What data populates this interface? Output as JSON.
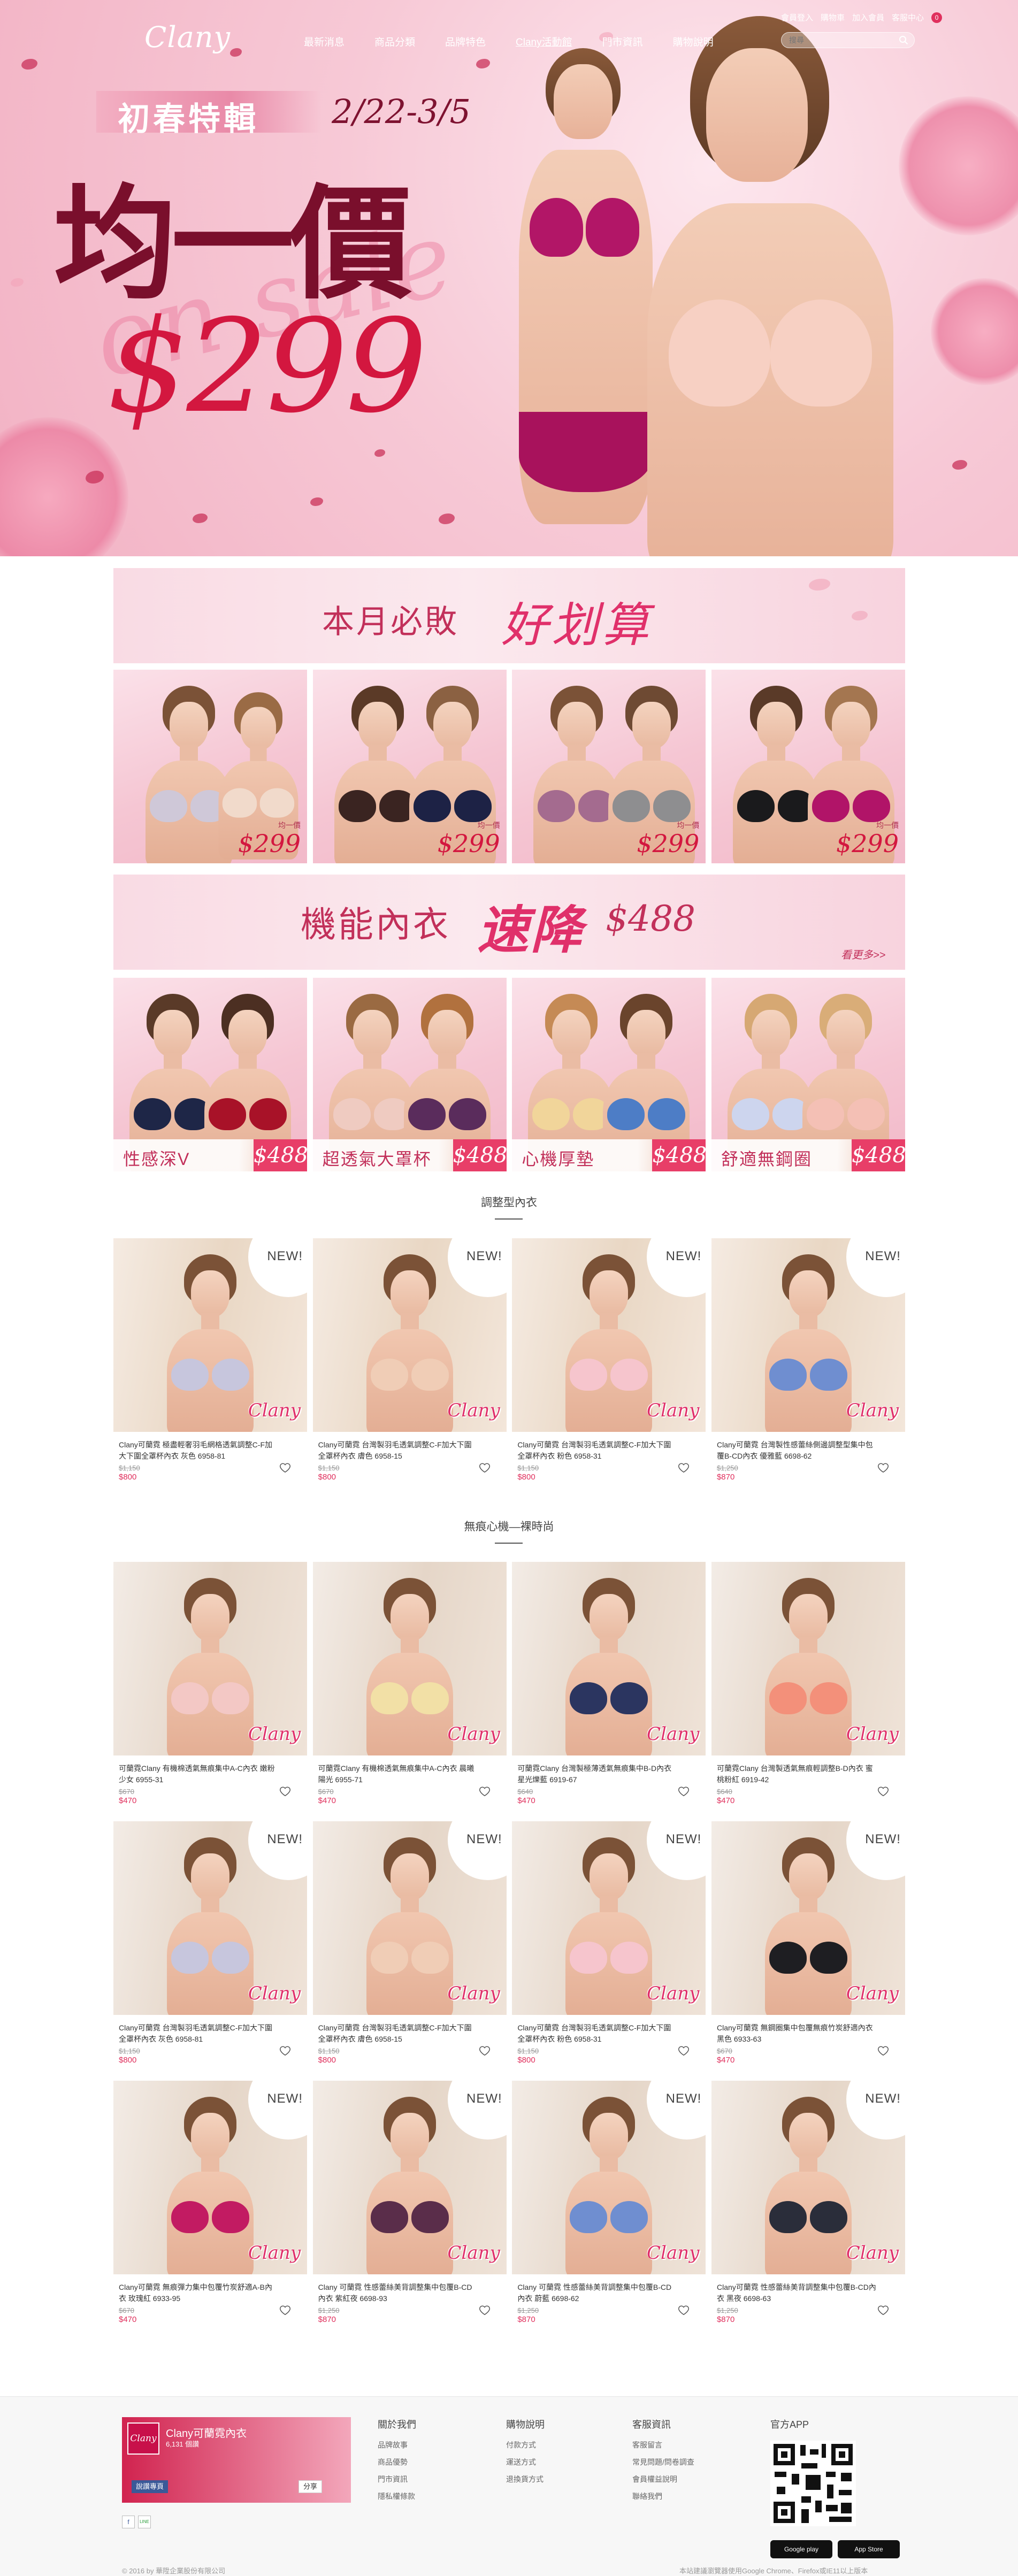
{
  "nav": {
    "logo": "Clany",
    "menu": [
      "最新消息",
      "商品分類",
      "品牌特色",
      "Clany活動館",
      "門市資訊",
      "購物說明"
    ],
    "active_index": 3,
    "util": [
      "會員登入",
      "購物車",
      "加入會員",
      "客服中心"
    ],
    "cart_count": "0",
    "search_placeholder": "搜尋"
  },
  "hero": {
    "tag": "初春特輯",
    "date": "2/22-3/5",
    "headline": "均一價",
    "sale_script": "on sale",
    "price": "$299"
  },
  "promo1": {
    "banner_lead": "本月必敗",
    "banner_em": "好划算",
    "tile_label": "均一價",
    "tile_price": "$299",
    "tile_count": 4
  },
  "promo2": {
    "banner_lead": "機能內衣",
    "banner_em": "速降",
    "banner_price": "$488",
    "more": "看更多>>",
    "tiles": [
      {
        "label": "性感深V",
        "price": "$488"
      },
      {
        "label": "超透氣大罩杯",
        "price": "$488"
      },
      {
        "label": "心機厚墊",
        "price": "$488"
      },
      {
        "label": "舒適無鋼圈",
        "price": "$488"
      }
    ]
  },
  "section1": {
    "title": "調整型內衣",
    "new_badge": "NEW!",
    "products": [
      {
        "name": "Clany可蘭霓 極盡輕奢羽毛網格透氣調整C-F加大下圍全罩杯內衣 灰色 6958-81",
        "old": "$1,150",
        "price": "$800",
        "color": "#c7c6dd",
        "new": true
      },
      {
        "name": "Clany可蘭霓 台灣製羽毛透氣調整C-F加大下圍全罩杯內衣 膚色 6958-15",
        "old": "$1,150",
        "price": "$800",
        "color": "#f0cdb6",
        "new": true
      },
      {
        "name": "Clany可蘭霓 台灣製羽毛透氣調整C-F加大下圍全罩杯內衣 粉色 6958-31",
        "old": "$1,150",
        "price": "$800",
        "color": "#f6c5cd",
        "new": true
      },
      {
        "name": "Clany可蘭霓 台灣製性感蕾絲側邊調整型集中包覆B-CD內衣 優雅藍 6698-62",
        "old": "$1,250",
        "price": "$870",
        "color": "#6f8ed0",
        "new": true
      }
    ]
  },
  "section2": {
    "title": "無痕心機—裸時尚",
    "rows": [
      [
        {
          "name": "可蘭霓Clany 有機棉透氣無痕集中A-C內衣 嫩粉少女 6955-31",
          "old": "$670",
          "price": "$470",
          "color": "#f3c8c5",
          "new": false
        },
        {
          "name": "可蘭霓Clany 有機棉透氣無痕集中A-C內衣 晨曦陽光 6955-71",
          "old": "$670",
          "price": "$470",
          "color": "#f2e0a6",
          "new": false
        },
        {
          "name": "可蘭霓Clany 台灣製極薄透氣無痕集中B-D內衣 星光爍藍 6919-67",
          "old": "$640",
          "price": "$470",
          "color": "#2b3560",
          "new": false
        },
        {
          "name": "可蘭霓Clany 台灣製透氣無痕輕調整B-D內衣 蜜桃粉紅 6919-42",
          "old": "$640",
          "price": "$470",
          "color": "#f3907a",
          "new": false
        }
      ],
      [
        {
          "name": "Clany可蘭霓 台灣製羽毛透氣調整C-F加大下圍全罩杯內衣 灰色 6958-81",
          "old": "$1,150",
          "price": "$800",
          "color": "#c7c6dd",
          "new": true
        },
        {
          "name": "Clany可蘭霓 台灣製羽毛透氣調整C-F加大下圍全罩杯內衣 膚色 6958-15",
          "old": "$1,150",
          "price": "$800",
          "color": "#f0cdb6",
          "new": true
        },
        {
          "name": "Clany可蘭霓 台灣製羽毛透氣調整C-F加大下圍全罩杯內衣 粉色 6958-31",
          "old": "$1,150",
          "price": "$800",
          "color": "#f6c5cd",
          "new": true
        },
        {
          "name": "Clany可蘭霓 無鋼圈集中包覆無痕竹炭舒適內衣 黑色 6933-63",
          "old": "$670",
          "price": "$470",
          "color": "#1e1e22",
          "new": true
        }
      ],
      [
        {
          "name": "Clany可蘭霓 無痕彈力集中包覆竹炭舒適A-B內衣 玫瑰紅 6933-95",
          "old": "$670",
          "price": "$470",
          "color": "#c21b62",
          "new": true
        },
        {
          "name": "Clany 可蘭霓 性感蕾絲美背調整集中包覆B-CD內衣 紫紅夜 6698-93",
          "old": "$1,250",
          "price": "$870",
          "color": "#5a2d4a",
          "new": true
        },
        {
          "name": "Clany 可蘭霓 性感蕾絲美背調整集中包覆B-CD內衣 蔚藍 6698-62",
          "old": "$1,250",
          "price": "$870",
          "color": "#6f8ed0",
          "new": true
        },
        {
          "name": "Clany可蘭霓 性感蕾絲美背調整集中包覆B-CD內衣 黑夜 6698-63",
          "old": "$1,250",
          "price": "$870",
          "color": "#2a2d3a",
          "new": true
        }
      ]
    ]
  },
  "footer": {
    "fb_name": "Clany可蘭霓內衣",
    "fb_likes": "6,131 個讚",
    "fb_like": "說讚專頁",
    "fb_share": "分享",
    "social": [
      "f",
      "LINE"
    ],
    "cols": [
      {
        "title": "關於我們",
        "links": [
          "品牌故事",
          "商品優勢",
          "門市資訊",
          "隱私權條款"
        ]
      },
      {
        "title": "購物說明",
        "links": [
          "付款方式",
          "運送方式",
          "退換貨方式"
        ]
      },
      {
        "title": "客服資訊",
        "links": [
          "客服留言",
          "常見問題/問卷調查",
          "會員權益說明",
          "聯絡我們"
        ]
      }
    ],
    "app_title": "官方APP",
    "google_play": "Google play",
    "app_store": "App Store",
    "copyright": "© 2016 by 華陞企業股份有限公司",
    "browser_note": "本站建議瀏覽器使用Google Chrome、Firefox或IE11以上版本"
  }
}
